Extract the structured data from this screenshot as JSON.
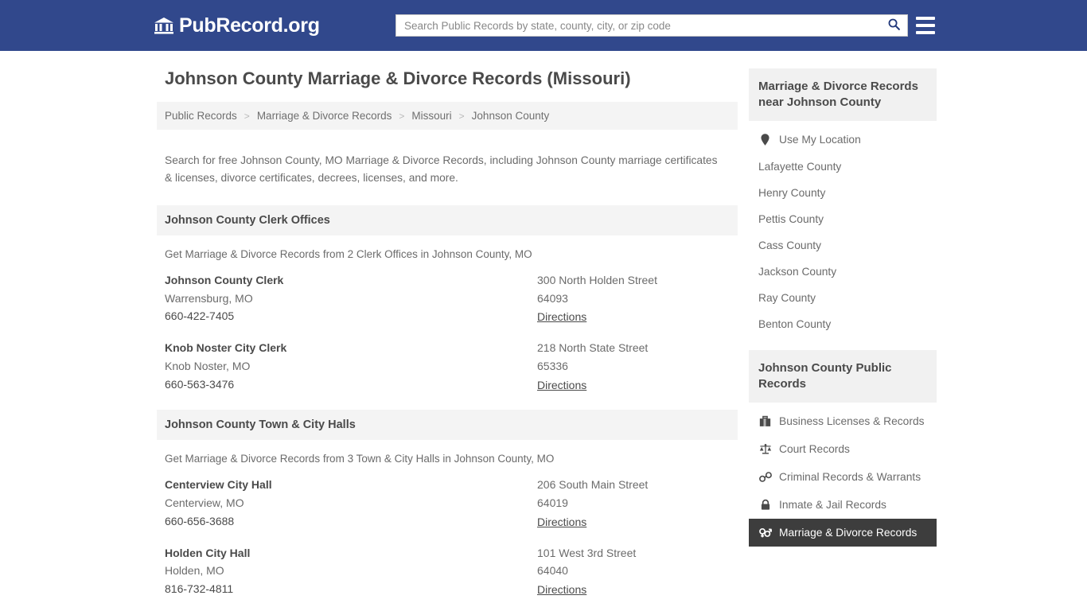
{
  "header": {
    "logo_text": "PubRecord.org",
    "logo_icon": "bank-building-icon",
    "search_placeholder": "Search Public Records by state, county, city, or zip code",
    "search_value": "",
    "search_icon": "search-icon",
    "menu_icon": "hamburger-menu-icon",
    "brand_color": "#31488c"
  },
  "page": {
    "title": "Johnson County Marriage & Divorce Records (Missouri)",
    "intro": "Search for free Johnson County, MO Marriage & Divorce Records, including Johnson County marriage certificates & licenses, divorce certificates, decrees, licenses, and more."
  },
  "breadcrumb": [
    {
      "label": "Public Records"
    },
    {
      "label": "Marriage & Divorce Records"
    },
    {
      "label": "Missouri"
    },
    {
      "label": "Johnson County"
    }
  ],
  "breadcrumb_separator": ">",
  "sections": [
    {
      "heading": "Johnson County Clerk Offices",
      "subtitle": "Get Marriage & Divorce Records from 2 Clerk Offices in Johnson County, MO",
      "listings": [
        {
          "name": "Johnson County Clerk",
          "city_state": "Warrensburg, MO",
          "phone": "660-422-7405",
          "street": "300 North Holden Street",
          "zip": "64093",
          "directions": "Directions"
        },
        {
          "name": "Knob Noster City Clerk",
          "city_state": "Knob Noster, MO",
          "phone": "660-563-3476",
          "street": "218 North State Street",
          "zip": "65336",
          "directions": "Directions"
        }
      ]
    },
    {
      "heading": "Johnson County Town & City Halls",
      "subtitle": "Get Marriage & Divorce Records from 3 Town & City Halls in Johnson County, MO",
      "listings": [
        {
          "name": "Centerview City Hall",
          "city_state": "Centerview, MO",
          "phone": "660-656-3688",
          "street": "206 South Main Street",
          "zip": "64019",
          "directions": "Directions"
        },
        {
          "name": "Holden City Hall",
          "city_state": "Holden, MO",
          "phone": "816-732-4811",
          "street": "101 West 3rd Street",
          "zip": "64040",
          "directions": "Directions"
        }
      ]
    }
  ],
  "sidebar": {
    "nearby": {
      "heading": "Marriage & Divorce Records near Johnson County",
      "use_my_location": {
        "label": "Use My Location",
        "icon": "map-pin-icon"
      },
      "counties": [
        {
          "label": "Lafayette County"
        },
        {
          "label": "Henry County"
        },
        {
          "label": "Pettis County"
        },
        {
          "label": "Cass County"
        },
        {
          "label": "Jackson County"
        },
        {
          "label": "Ray County"
        },
        {
          "label": "Benton County"
        }
      ]
    },
    "public_records": {
      "heading": "Johnson County Public Records",
      "items": [
        {
          "label": "Business Licenses & Records",
          "icon": "briefcase-icon",
          "active": false
        },
        {
          "label": "Court Records",
          "icon": "scales-of-justice-icon",
          "active": false
        },
        {
          "label": "Criminal Records & Warrants",
          "icon": "handcuffs-icon",
          "active": false
        },
        {
          "label": "Inmate & Jail Records",
          "icon": "lock-icon",
          "active": false
        },
        {
          "label": "Marriage & Divorce Records",
          "icon": "venus-mars-icon",
          "active": true
        }
      ],
      "active_bg": "#3d3d3d",
      "active_fg": "#ffffff"
    }
  }
}
